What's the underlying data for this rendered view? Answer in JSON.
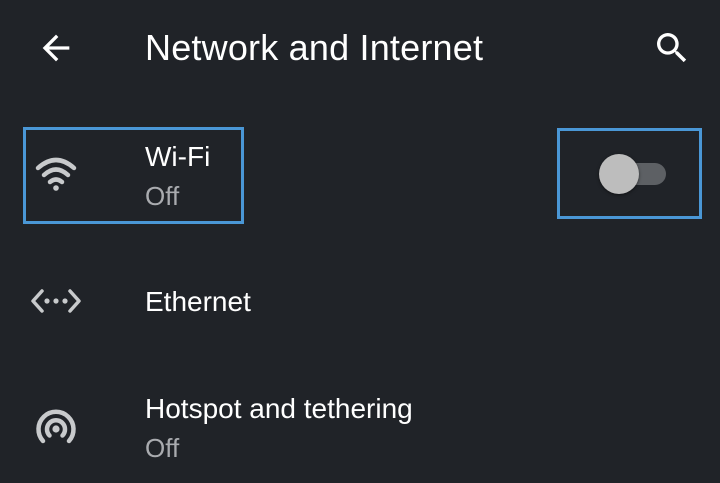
{
  "appbar": {
    "title": "Network and Internet",
    "back_icon": "arrow-back-icon",
    "search_icon": "search-icon"
  },
  "items": [
    {
      "title": "Wi-Fi",
      "subtitle": "Off",
      "icon": "wifi-icon",
      "toggle_on": false
    },
    {
      "title": "Ethernet",
      "icon": "ethernet-icon"
    },
    {
      "title": "Hotspot and tethering",
      "subtitle": "Off",
      "icon": "hotspot-icon"
    }
  ],
  "colors": {
    "background": "#202328",
    "highlight": "#4a97d6",
    "subtitle": "#a9abaf",
    "icon": "#c8cacc"
  }
}
